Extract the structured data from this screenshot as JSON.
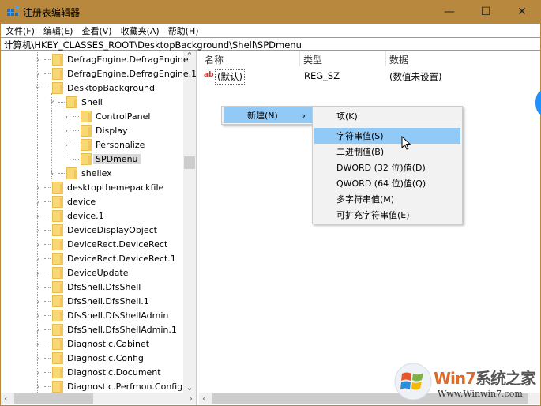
{
  "window": {
    "title": "注册表编辑器",
    "minimize": "—",
    "maximize": "☐",
    "close": "✕",
    "app_icon": "regedit-icon",
    "accent": "#b8883e"
  },
  "menubar": [
    "文件(F)",
    "编辑(E)",
    "查看(V)",
    "收藏夹(A)",
    "帮助(H)"
  ],
  "address": "计算机\\HKEY_CLASSES_ROOT\\DesktopBackground\\Shell\\SPDmenu",
  "tree": [
    {
      "label": "DefragEngine.DefragEngine",
      "level": 1,
      "expander": "collapsed"
    },
    {
      "label": "DefragEngine.DefragEngine.1",
      "level": 1,
      "expander": "collapsed"
    },
    {
      "label": "DesktopBackground",
      "level": 1,
      "expander": "expanded"
    },
    {
      "label": "Shell",
      "level": 2,
      "expander": "expanded"
    },
    {
      "label": "ControlPanel",
      "level": 3,
      "expander": "collapsed"
    },
    {
      "label": "Display",
      "level": 3,
      "expander": "collapsed"
    },
    {
      "label": "Personalize",
      "level": 3,
      "expander": "collapsed"
    },
    {
      "label": "SPDmenu",
      "level": 3,
      "expander": "none",
      "selected": true
    },
    {
      "label": "shellex",
      "level": 2,
      "expander": "collapsed"
    },
    {
      "label": "desktopthemepackfile",
      "level": 1,
      "expander": "collapsed"
    },
    {
      "label": "device",
      "level": 1,
      "expander": "collapsed"
    },
    {
      "label": "device.1",
      "level": 1,
      "expander": "collapsed"
    },
    {
      "label": "DeviceDisplayObject",
      "level": 1,
      "expander": "collapsed"
    },
    {
      "label": "DeviceRect.DeviceRect",
      "level": 1,
      "expander": "collapsed"
    },
    {
      "label": "DeviceRect.DeviceRect.1",
      "level": 1,
      "expander": "collapsed"
    },
    {
      "label": "DeviceUpdate",
      "level": 1,
      "expander": "collapsed"
    },
    {
      "label": "DfsShell.DfsShell",
      "level": 1,
      "expander": "collapsed"
    },
    {
      "label": "DfsShell.DfsShell.1",
      "level": 1,
      "expander": "collapsed"
    },
    {
      "label": "DfsShell.DfsShellAdmin",
      "level": 1,
      "expander": "collapsed"
    },
    {
      "label": "DfsShell.DfsShellAdmin.1",
      "level": 1,
      "expander": "collapsed"
    },
    {
      "label": "Diagnostic.Cabinet",
      "level": 1,
      "expander": "collapsed"
    },
    {
      "label": "Diagnostic.Config",
      "level": 1,
      "expander": "collapsed"
    },
    {
      "label": "Diagnostic.Document",
      "level": 1,
      "expander": "collapsed"
    },
    {
      "label": "Diagnostic.Perfmon.Config",
      "level": 1,
      "expander": "collapsed"
    }
  ],
  "values": {
    "headers": [
      "名称",
      "类型",
      "数据"
    ],
    "rows": [
      {
        "name": "(默认)",
        "type": "REG_SZ",
        "data": "(数值未设置)",
        "icon": "string-value-icon"
      }
    ]
  },
  "context_menu": {
    "item": "新建(N)",
    "arrow": "›"
  },
  "submenu": [
    "项(K)",
    "字符串值(S)",
    "二进制值(B)",
    "DWORD (32 位)值(D)",
    "QWORD (64 位)值(Q)",
    "多字符串值(M)",
    "可扩充字符串值(E)"
  ],
  "submenu_highlight": "字符串值(S)",
  "watermark": {
    "text": "Win7系统之家",
    "url": "Www.Winwin7.com"
  },
  "scroll": {
    "up": "⌃",
    "down": "⌄",
    "left": "‹",
    "right": "›"
  }
}
